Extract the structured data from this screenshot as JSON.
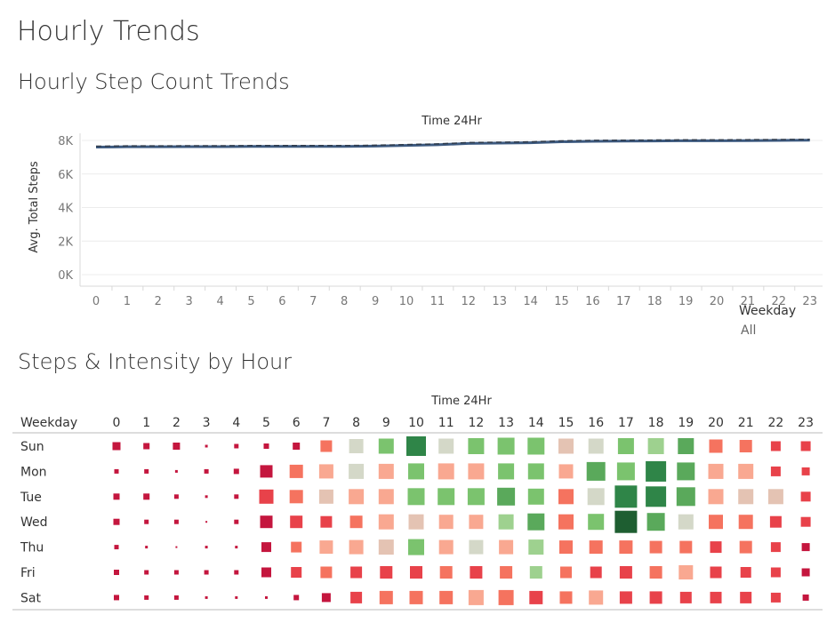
{
  "page": {
    "title": "Hourly Trends"
  },
  "line_section": {
    "title": "Hourly Step Count Trends"
  },
  "heatmap_section": {
    "title": "Steps & Intensity by Hour"
  },
  "filter": {
    "label": "Weekday",
    "value": "All"
  },
  "colors": {
    "line_main": "#3d5a80",
    "line_dashed": "#2e3a4a",
    "gridline": "#ececec",
    "red_dark": "#c4163e",
    "red": "#e8424a",
    "salmon": "#f5735f",
    "light_salmon": "#f9a891",
    "beige": "#e4c3b3",
    "gray_green": "#d4d8c8",
    "light_green": "#9ed18f",
    "green": "#7bc36e",
    "mid_green": "#5aa95b",
    "dark_green": "#2f8548",
    "darkest_green": "#1e5e31"
  },
  "chart_data": [
    {
      "type": "line",
      "title": "Time 24Hr",
      "xlabel": "Time 24Hr",
      "ylabel": "Avg. Total Steps",
      "x": [
        0,
        1,
        2,
        3,
        4,
        5,
        6,
        7,
        8,
        9,
        10,
        11,
        12,
        13,
        14,
        15,
        16,
        17,
        18,
        19,
        20,
        21,
        22,
        23
      ],
      "ytick_labels": [
        "0K",
        "2K",
        "4K",
        "6K",
        "8K"
      ],
      "ylim": [
        0,
        8000
      ],
      "series": [
        {
          "values": [
            7600,
            7620,
            7620,
            7630,
            7630,
            7640,
            7640,
            7640,
            7640,
            7660,
            7700,
            7740,
            7820,
            7840,
            7860,
            7920,
            7950,
            7960,
            7970,
            7980,
            7980,
            7990,
            8000,
            8010
          ]
        }
      ]
    },
    {
      "type": "heatmap",
      "title": "Time 24Hr",
      "row_header": "Weekday",
      "columns": [
        "0",
        "1",
        "2",
        "3",
        "4",
        "5",
        "6",
        "7",
        "8",
        "9",
        "10",
        "11",
        "12",
        "13",
        "14",
        "15",
        "16",
        "17",
        "18",
        "19",
        "20",
        "21",
        "22",
        "23"
      ],
      "rows": [
        "Sun",
        "Mon",
        "Tue",
        "Wed",
        "Thu",
        "Fri",
        "Sat"
      ],
      "size": [
        [
          9,
          7,
          8,
          3,
          5,
          6,
          8,
          13,
          16,
          17,
          22,
          17,
          18,
          19,
          19,
          17,
          17,
          18,
          18,
          18,
          15,
          14,
          11,
          11
        ],
        [
          5,
          5,
          3,
          5,
          6,
          14,
          15,
          16,
          17,
          17,
          18,
          18,
          18,
          18,
          18,
          16,
          21,
          20,
          23,
          20,
          17,
          17,
          11,
          9
        ],
        [
          7,
          7,
          5,
          3,
          5,
          16,
          15,
          16,
          17,
          17,
          19,
          19,
          19,
          20,
          18,
          17,
          19,
          25,
          23,
          21,
          17,
          17,
          17,
          11
        ],
        [
          7,
          5,
          5,
          2,
          5,
          14,
          14,
          13,
          14,
          17,
          17,
          16,
          16,
          17,
          19,
          17,
          18,
          25,
          20,
          17,
          16,
          16,
          13,
          11
        ],
        [
          5,
          3,
          2,
          3,
          3,
          11,
          12,
          15,
          16,
          17,
          18,
          16,
          16,
          16,
          17,
          15,
          15,
          15,
          14,
          14,
          13,
          14,
          11,
          9
        ],
        [
          6,
          5,
          5,
          5,
          5,
          11,
          12,
          13,
          13,
          14,
          14,
          14,
          14,
          14,
          14,
          13,
          13,
          14,
          14,
          16,
          13,
          12,
          11,
          9
        ],
        [
          6,
          5,
          5,
          3,
          3,
          3,
          6,
          10,
          13,
          15,
          15,
          15,
          17,
          17,
          15,
          14,
          16,
          14,
          14,
          13,
          13,
          13,
          11,
          7
        ]
      ],
      "color": [
        [
          "red_dark",
          "red_dark",
          "red_dark",
          "red_dark",
          "red_dark",
          "red_dark",
          "red_dark",
          "salmon",
          "gray_green",
          "green",
          "dark_green",
          "gray_green",
          "green",
          "green",
          "green",
          "beige",
          "gray_green",
          "green",
          "light_green",
          "mid_green",
          "salmon",
          "salmon",
          "red",
          "red"
        ],
        [
          "red_dark",
          "red_dark",
          "red_dark",
          "red_dark",
          "red_dark",
          "red_dark",
          "salmon",
          "light_salmon",
          "gray_green",
          "light_salmon",
          "green",
          "light_salmon",
          "light_salmon",
          "green",
          "green",
          "light_salmon",
          "mid_green",
          "green",
          "dark_green",
          "mid_green",
          "light_salmon",
          "light_salmon",
          "red",
          "red"
        ],
        [
          "red_dark",
          "red_dark",
          "red_dark",
          "red_dark",
          "red_dark",
          "red",
          "salmon",
          "beige",
          "light_salmon",
          "light_salmon",
          "green",
          "green",
          "green",
          "mid_green",
          "green",
          "salmon",
          "gray_green",
          "dark_green",
          "dark_green",
          "mid_green",
          "light_salmon",
          "beige",
          "beige",
          "red"
        ],
        [
          "red_dark",
          "red_dark",
          "red_dark",
          "red_dark",
          "red_dark",
          "red_dark",
          "red",
          "red",
          "salmon",
          "light_salmon",
          "beige",
          "light_salmon",
          "light_salmon",
          "light_green",
          "mid_green",
          "salmon",
          "green",
          "darkest_green",
          "mid_green",
          "gray_green",
          "salmon",
          "salmon",
          "red",
          "red"
        ],
        [
          "red_dark",
          "red_dark",
          "red_dark",
          "red_dark",
          "red_dark",
          "red_dark",
          "salmon",
          "light_salmon",
          "light_salmon",
          "beige",
          "green",
          "light_salmon",
          "gray_green",
          "light_salmon",
          "light_green",
          "salmon",
          "salmon",
          "salmon",
          "salmon",
          "salmon",
          "red",
          "salmon",
          "red",
          "red_dark"
        ],
        [
          "red_dark",
          "red_dark",
          "red_dark",
          "red_dark",
          "red_dark",
          "red_dark",
          "red",
          "salmon",
          "red",
          "red",
          "red",
          "salmon",
          "red",
          "salmon",
          "light_green",
          "salmon",
          "red",
          "red",
          "salmon",
          "light_salmon",
          "red",
          "red",
          "red",
          "red_dark"
        ],
        [
          "red_dark",
          "red_dark",
          "red_dark",
          "red_dark",
          "red_dark",
          "red_dark",
          "red_dark",
          "red_dark",
          "red",
          "salmon",
          "salmon",
          "salmon",
          "light_salmon",
          "salmon",
          "red",
          "salmon",
          "light_salmon",
          "red",
          "red",
          "red",
          "red",
          "red",
          "red",
          "red_dark"
        ]
      ]
    }
  ]
}
